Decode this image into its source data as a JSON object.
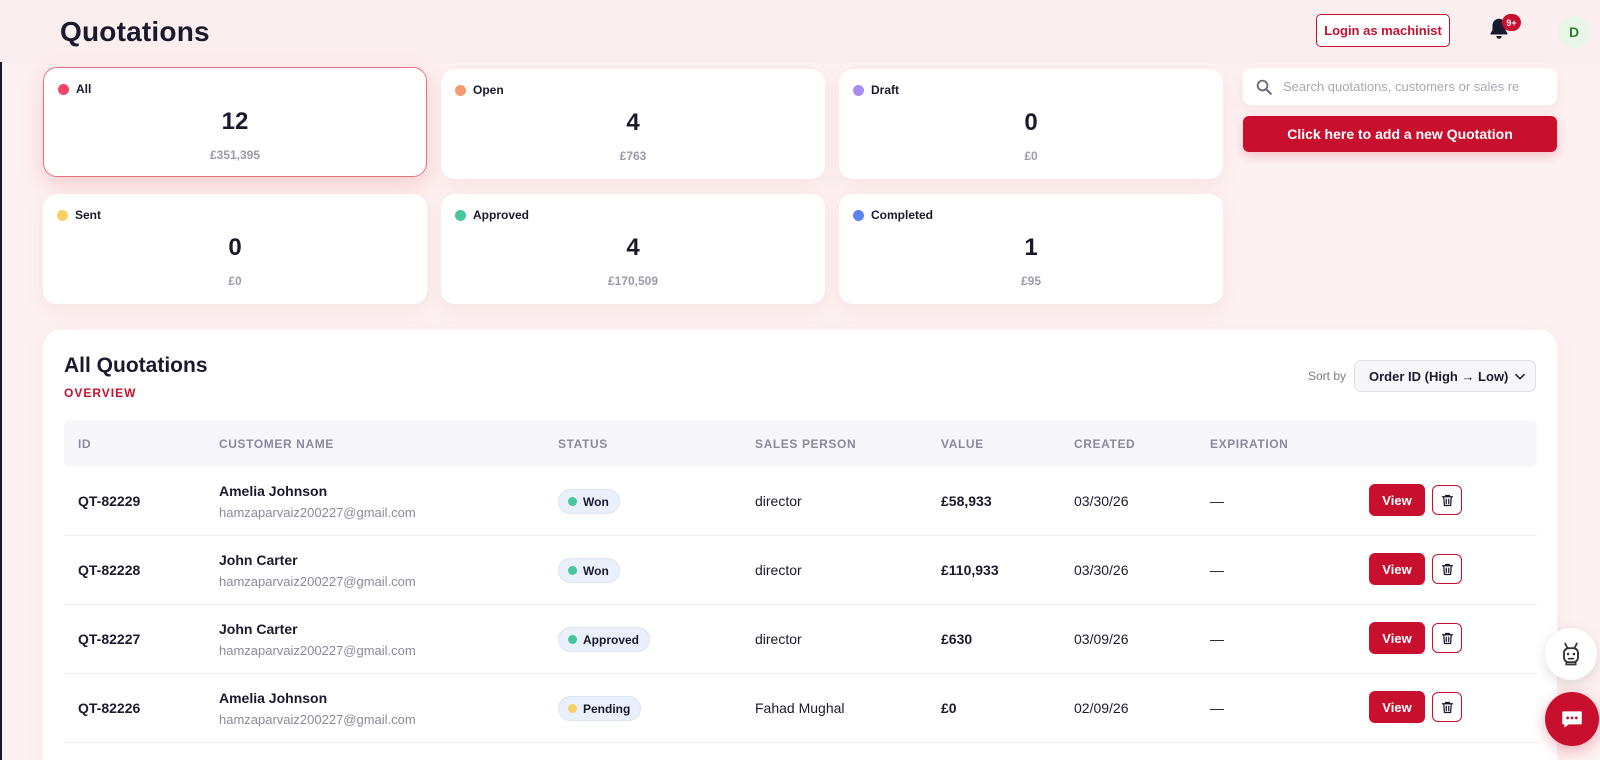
{
  "header": {
    "title": "Quotations",
    "login_label": "Login as machinist",
    "notifications_badge": "9+",
    "avatar_initial": "D"
  },
  "stats": [
    {
      "label": "All",
      "count": "12",
      "value": "£351,395",
      "dot_color": "#f0466a",
      "active": true
    },
    {
      "label": "Open",
      "count": "4",
      "value": "£763",
      "dot_color": "#f59a6e",
      "active": false
    },
    {
      "label": "Draft",
      "count": "0",
      "value": "£0",
      "dot_color": "#a88df0",
      "active": false
    },
    {
      "label": "Sent",
      "count": "0",
      "value": "£0",
      "dot_color": "#f7cf62",
      "active": false
    },
    {
      "label": "Approved",
      "count": "4",
      "value": "£170,509",
      "dot_color": "#45c79a",
      "active": false
    },
    {
      "label": "Completed",
      "count": "1",
      "value": "£95",
      "dot_color": "#5b82f0",
      "active": false
    }
  ],
  "search": {
    "placeholder": "Search quotations, customers or sales re"
  },
  "add_button_label": "Click here to add a new Quotation",
  "panel": {
    "title": "All Quotations",
    "subtitle": "OVERVIEW",
    "sort_label": "Sort by",
    "sort_value": "Order ID (High → Low)"
  },
  "table": {
    "headers": [
      "ID",
      "CUSTOMER NAME",
      "STATUS",
      "SALES PERSON",
      "VALUE",
      "CREATED",
      "EXPIRATION"
    ],
    "view_label": "View",
    "rows": [
      {
        "id": "QT-82229",
        "name": "Amelia Johnson",
        "email": "hamzaparvaiz200227@gmail.com",
        "status": "Won",
        "status_color": "#45c79a",
        "sales": "director",
        "value": "£58,933",
        "created": "03/30/26",
        "expiration": "—"
      },
      {
        "id": "QT-82228",
        "name": "John Carter",
        "email": "hamzaparvaiz200227@gmail.com",
        "status": "Won",
        "status_color": "#45c79a",
        "sales": "director",
        "value": "£110,933",
        "created": "03/30/26",
        "expiration": "—"
      },
      {
        "id": "QT-82227",
        "name": "John Carter",
        "email": "hamzaparvaiz200227@gmail.com",
        "status": "Approved",
        "status_color": "#45c79a",
        "sales": "director",
        "value": "£630",
        "created": "03/09/26",
        "expiration": "—"
      },
      {
        "id": "QT-82226",
        "name": "Amelia Johnson",
        "email": "hamzaparvaiz200227@gmail.com",
        "status": "Pending",
        "status_color": "#f7cf62",
        "sales": "Fahad Mughal",
        "value": "£0",
        "created": "02/09/26",
        "expiration": "—"
      }
    ]
  },
  "colors": {
    "accent": "#c8102e",
    "page_bg": "#fdf1f1"
  }
}
